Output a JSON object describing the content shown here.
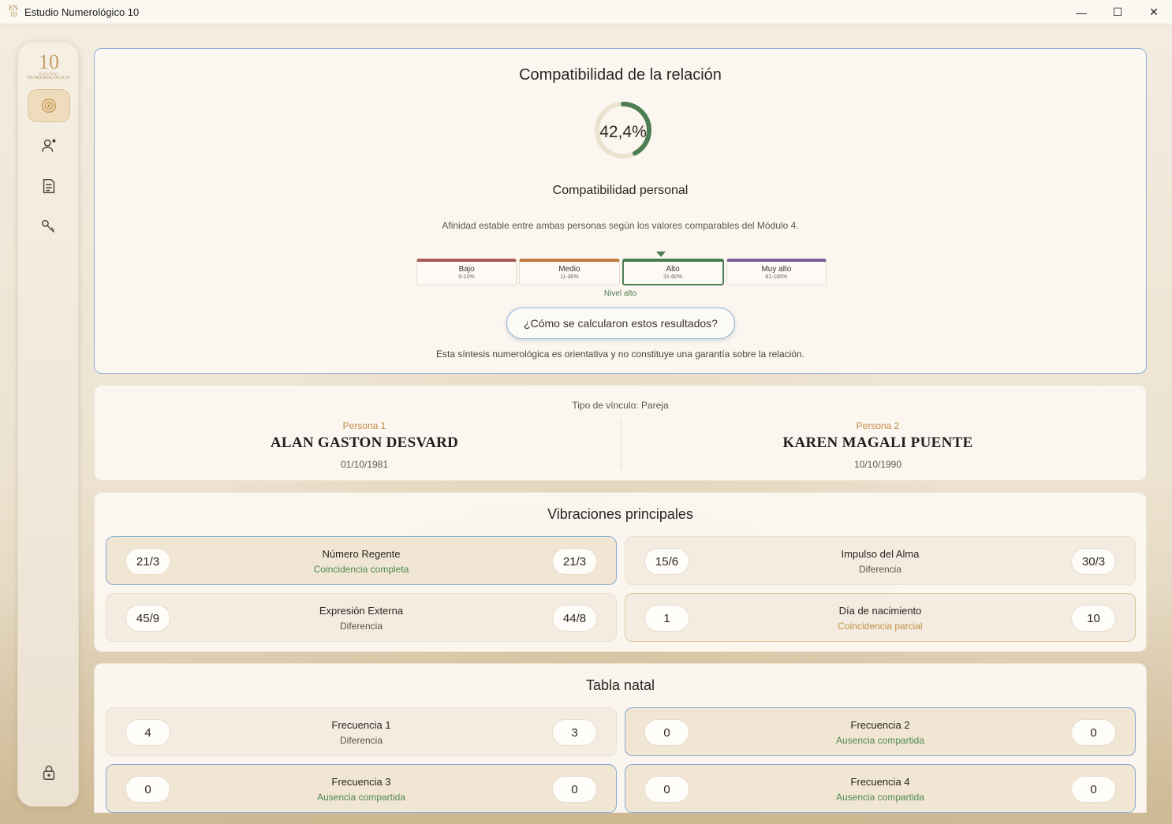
{
  "window": {
    "title": "Estudio Numerológico 10",
    "minimize": "—",
    "maximize": "☐",
    "close": "✕"
  },
  "logo": {
    "number": "10",
    "line1": "ESTUDIO",
    "line2": "NUMEROLÓGICO"
  },
  "sidebar": {
    "items": [
      {
        "icon": "compatibility-icon",
        "active": true
      },
      {
        "icon": "user-icon",
        "active": false
      },
      {
        "icon": "document-icon",
        "active": false
      },
      {
        "icon": "key-icon",
        "active": false
      }
    ],
    "bottom_icon": "lock-icon"
  },
  "compat": {
    "title": "Compatibilidad de la relación",
    "percent": 42.4,
    "percent_label": "42,4%",
    "subtitle": "Compatibilidad personal",
    "description": "Afinidad estable entre ambas personas según los valores comparables del Módulo 4.",
    "levels": [
      {
        "name": "Bajo",
        "range": "0-10%",
        "color": "#a85a55"
      },
      {
        "name": "Medio",
        "range": "11-30%",
        "color": "#c07a3c"
      },
      {
        "name": "Alto",
        "range": "31-60%",
        "color": "#4d7d52"
      },
      {
        "name": "Muy alto",
        "range": "61-100%",
        "color": "#7b5f99"
      }
    ],
    "active_level": 2,
    "level_label": "Nivel alto",
    "calc_button": "¿Cómo se calcularon estos resultados?",
    "disclaimer": "Esta síntesis numerológica es orientativa y no constituye una garantía sobre la relación."
  },
  "persons": {
    "type_label": "Tipo de vínculo: Pareja",
    "p1": {
      "label": "Persona 1",
      "name": "ALAN GASTON DESVARD",
      "date": "01/10/1981"
    },
    "p2": {
      "label": "Persona 2",
      "name": "KAREN MAGALI PUENTE",
      "date": "10/10/1990"
    }
  },
  "vibraciones": {
    "title": "Vibraciones principales",
    "cards": [
      {
        "left": "21/3",
        "title": "Número Regente",
        "status": "Coincidencia completa",
        "right": "21/3"
      },
      {
        "left": "15/6",
        "title": "Impulso del Alma",
        "status": "Diferencia",
        "right": "30/3"
      },
      {
        "left": "45/9",
        "title": "Expresión Externa",
        "status": "Diferencia",
        "right": "44/8"
      },
      {
        "left": "1",
        "title": "Día de nacimiento",
        "status": "Coincidencia parcial",
        "right": "10"
      }
    ]
  },
  "tabla": {
    "title": "Tabla natal",
    "cards": [
      {
        "left": "4",
        "title": "Frecuencia 1",
        "status": "Diferencia",
        "right": "3"
      },
      {
        "left": "0",
        "title": "Frecuencia 2",
        "status": "Ausencia compartida",
        "right": "0"
      },
      {
        "left": "0",
        "title": "Frecuencia 3",
        "status": "Ausencia compartida",
        "right": "0"
      },
      {
        "left": "0",
        "title": "Frecuencia 4",
        "status": "Ausencia compartida",
        "right": "0"
      }
    ]
  }
}
